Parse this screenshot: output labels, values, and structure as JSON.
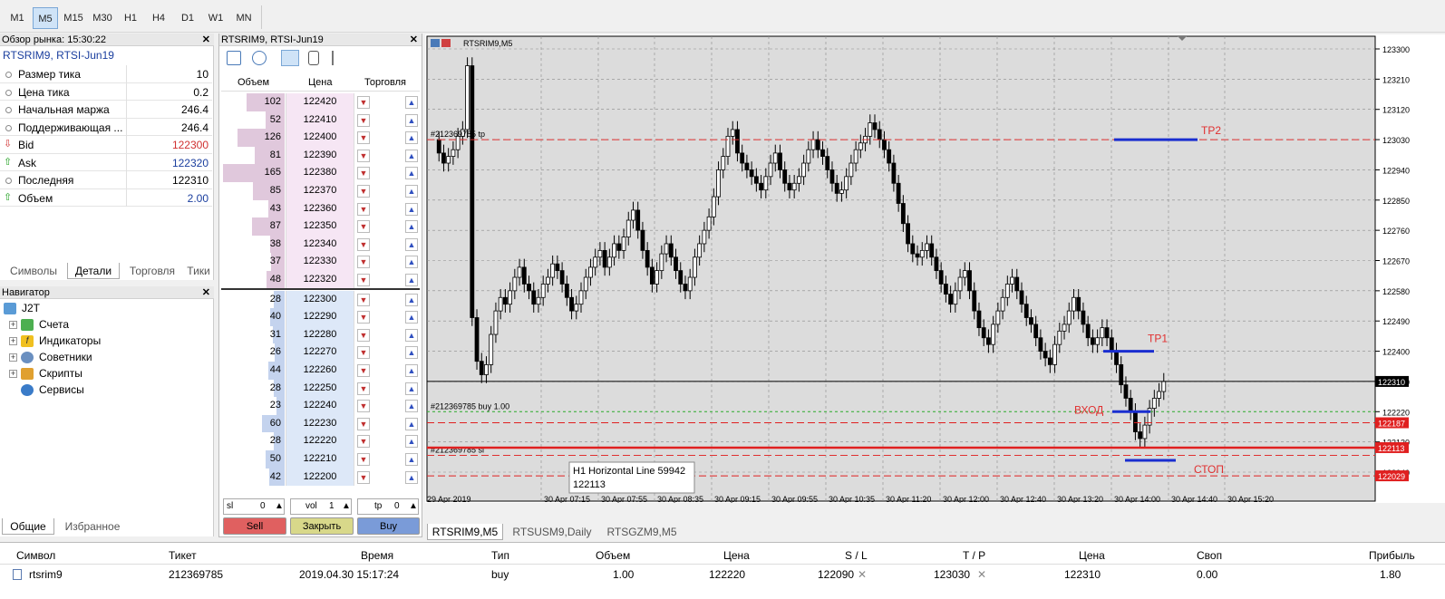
{
  "timeframes": {
    "items": [
      "M1",
      "M5",
      "M15",
      "M30",
      "H1",
      "H4",
      "D1",
      "W1",
      "MN"
    ],
    "active": "M5"
  },
  "market_watch": {
    "title": "Обзор рынка: 15:30:22",
    "symbol_line": "RTSRIM9, RTSI-Jun19",
    "rows": [
      {
        "label": "Размер тика",
        "value": "10"
      },
      {
        "label": "Цена тика",
        "value": "0.2"
      },
      {
        "label": "Начальная маржа",
        "value": "246.4"
      },
      {
        "label": "Поддерживающая ...",
        "value": "246.4"
      },
      {
        "label": "Bid",
        "value": "122300"
      },
      {
        "label": "Ask",
        "value": "122320"
      },
      {
        "label": "Последняя",
        "value": "122310"
      },
      {
        "label": "Объем",
        "value": "2.00"
      }
    ],
    "tabs": [
      "Символы",
      "Детали",
      "Торговля",
      "Тики"
    ]
  },
  "navigator": {
    "title": "Навигатор",
    "root": "J2T",
    "items": [
      "Счета",
      "Индикаторы",
      "Советники",
      "Скрипты",
      "Сервисы"
    ],
    "tabs": [
      "Общие",
      "Избранное"
    ]
  },
  "dom": {
    "title": "RTSRIM9, RTSI-Jun19",
    "headers": {
      "volume": "Объем",
      "price": "Цена",
      "trade": "Торговля"
    },
    "asks": [
      {
        "vol": "102",
        "price": "122420"
      },
      {
        "vol": "52",
        "price": "122410"
      },
      {
        "vol": "126",
        "price": "122400"
      },
      {
        "vol": "81",
        "price": "122390"
      },
      {
        "vol": "165",
        "price": "122380"
      },
      {
        "vol": "85",
        "price": "122370"
      },
      {
        "vol": "43",
        "price": "122360"
      },
      {
        "vol": "87",
        "price": "122350"
      },
      {
        "vol": "38",
        "price": "122340"
      },
      {
        "vol": "37",
        "price": "122330"
      },
      {
        "vol": "48",
        "price": "122320"
      }
    ],
    "bids": [
      {
        "vol": "28",
        "price": "122300"
      },
      {
        "vol": "40",
        "price": "122290"
      },
      {
        "vol": "31",
        "price": "122280"
      },
      {
        "vol": "26",
        "price": "122270"
      },
      {
        "vol": "44",
        "price": "122260"
      },
      {
        "vol": "28",
        "price": "122250"
      },
      {
        "vol": "23",
        "price": "122240"
      },
      {
        "vol": "60",
        "price": "122230"
      },
      {
        "vol": "28",
        "price": "122220"
      },
      {
        "vol": "50",
        "price": "122210"
      },
      {
        "vol": "42",
        "price": "122200"
      }
    ],
    "sl_label": "sl",
    "sl_value": "0",
    "vol_label": "vol",
    "vol_value": "1",
    "tp_label": "tp",
    "tp_value": "0",
    "sell_label": "Sell",
    "close_label": "Закрыть",
    "buy_label": "Buy",
    "colors": {
      "sell": "#e06060",
      "close": "#d8d88a",
      "buy": "#7a9bd8",
      "ask_bg": "#f6e6f4",
      "bid_bg": "#dde8f8"
    }
  },
  "chart": {
    "title": "RTSRIM9,M5",
    "y_ticks": [
      "123300",
      "123210",
      "123120",
      "123030",
      "122940",
      "122850",
      "122760",
      "122670",
      "122580",
      "122490",
      "122400",
      "122310",
      "122220",
      "122130",
      "122040"
    ],
    "x_ticks": [
      "29 Apr 2019",
      "30 Apr 07:15",
      "30 Apr 07:55",
      "30 Apr 08:35",
      "30 Apr 09:15",
      "30 Apr 09:55",
      "30 Apr 10:35",
      "30 Apr 11:20",
      "30 Apr 12:00",
      "30 Apr 12:40",
      "30 Apr 13:20",
      "30 Apr 14:00",
      "30 Apr 14:40",
      "30 Apr 15:20"
    ],
    "current_price": "122310",
    "tp_line": {
      "label": "#212369785 tp",
      "price": "123030"
    },
    "buy_line": {
      "label": "#212369785 buy 1.00",
      "price": "122220"
    },
    "sl_line": {
      "label": "#212369785 sl",
      "price": "122090"
    },
    "red_tags": [
      "122187",
      "122113",
      "122029"
    ],
    "annotations": {
      "tp2": "TP2",
      "tp1": "TP1",
      "entry": "ВХОД",
      "stop": "СТОП"
    },
    "tooltip": {
      "line1": "H1 Horizontal Line 59942",
      "line2": "122113"
    },
    "tabs": [
      "RTSRIM9,M5",
      "RTSUSM9,Daily",
      "RTSGZM9,M5"
    ]
  },
  "terminal": {
    "headers": [
      "Символ",
      "Тикет",
      "Время",
      "Тип",
      "Объем",
      "Цена",
      "S / L",
      "T / P",
      "Цена",
      "Своп",
      "Прибыль"
    ],
    "row": [
      "rtsrim9",
      "212369785",
      "2019.04.30 15:17:24",
      "buy",
      "1.00",
      "122220",
      "122090",
      "123030",
      "122310",
      "0.00",
      "1.80"
    ]
  }
}
